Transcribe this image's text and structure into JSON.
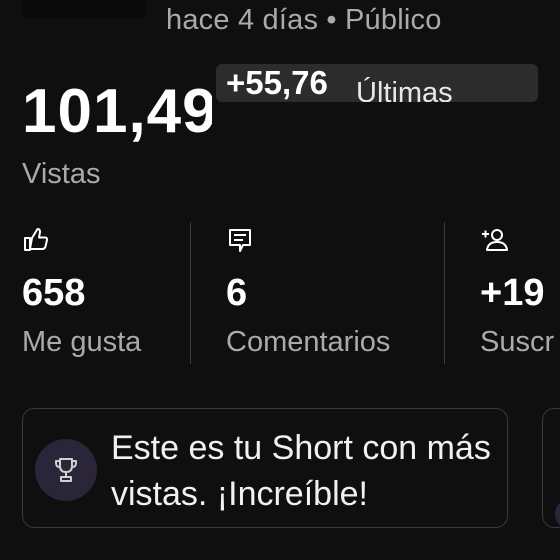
{
  "video": {
    "meta": "hace 4 días • Público"
  },
  "views": {
    "total": "101,49",
    "delta": "+55,76",
    "delta_label": "Últimas",
    "label": "Vistas"
  },
  "stats": [
    {
      "icon": "thumbs-up-icon",
      "value": "658",
      "label": "Me gusta"
    },
    {
      "icon": "comment-icon",
      "value": "6",
      "label": "Comentarios"
    },
    {
      "icon": "add-subscriber-icon",
      "value": "+19",
      "label": "Suscr"
    }
  ],
  "highlight_card": {
    "icon": "trophy-icon",
    "text": "Este es tu Short con más vistas. ¡Increíble!"
  },
  "colors": {
    "background": "#0f0f0f",
    "secondary_text": "#aaaaaa",
    "badge_bg": "#2c2c2c",
    "trophy_circle": "#2a2538"
  }
}
